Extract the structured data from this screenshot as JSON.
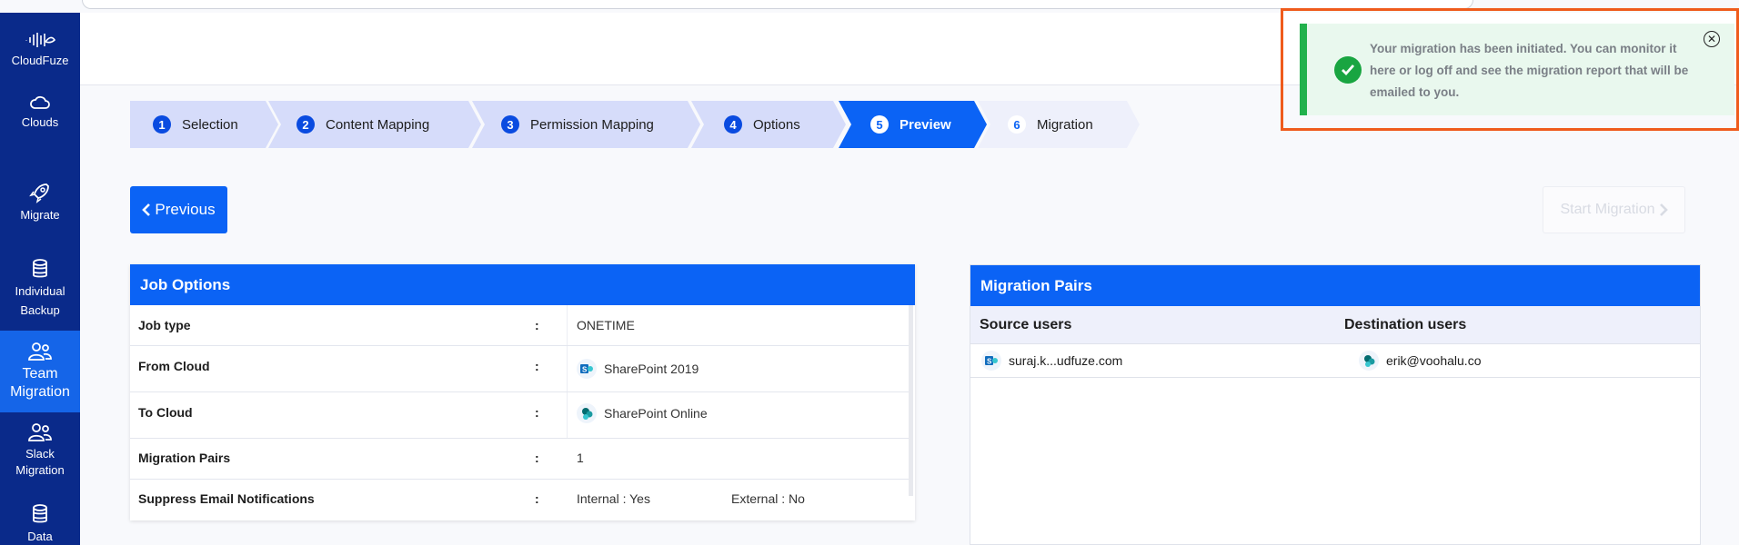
{
  "sidebar": {
    "brand": "CloudFuze",
    "items": [
      {
        "label": "Clouds",
        "icon": "cloud-icon"
      },
      {
        "label": "Migrate",
        "icon": "rocket-icon"
      },
      {
        "label_line1": "Individual",
        "label_line2": "Backup",
        "icon": "database-icon"
      },
      {
        "label_line1": "Team",
        "label_line2": "Migration",
        "icon": "users-icon",
        "active": true
      },
      {
        "label_line1": "Slack",
        "label_line2": "Migration",
        "icon": "users-icon"
      },
      {
        "label": "Data",
        "icon": "database-icon"
      }
    ]
  },
  "stepper": {
    "steps": [
      {
        "num": "1",
        "label": "Selection"
      },
      {
        "num": "2",
        "label": "Content Mapping"
      },
      {
        "num": "3",
        "label": "Permission Mapping"
      },
      {
        "num": "4",
        "label": "Options"
      },
      {
        "num": "5",
        "label": "Preview",
        "active": true
      },
      {
        "num": "6",
        "label": "Migration"
      }
    ]
  },
  "actions": {
    "previous": "Previous",
    "start": "Start Migration"
  },
  "job_options": {
    "title": "Job Options",
    "rows": [
      {
        "key": "Job type",
        "sep": ":",
        "value": "ONETIME"
      },
      {
        "key": "From Cloud",
        "sep": ":",
        "value": "SharePoint 2019"
      },
      {
        "key": "To Cloud",
        "sep": ":",
        "value": "SharePoint Online"
      },
      {
        "key": "Migration Pairs",
        "sep": ":",
        "value": "1"
      },
      {
        "key": "Suppress Email Notifications",
        "sep": ":",
        "value": "Internal : Yes",
        "value2": "External : No"
      }
    ]
  },
  "migration_pairs": {
    "title": "Migration Pairs",
    "columns": [
      "Source users",
      "Destination users"
    ],
    "rows": [
      {
        "source": "suraj.k...udfuze.com",
        "destination": "erik@voohalu.co"
      }
    ]
  },
  "toast": {
    "message": "Your migration has been initiated. You can monitor it here or log off and see the migration report that will be emailed to you.",
    "status_color": "#22b14c",
    "highlight_color": "#ef5b1c"
  }
}
